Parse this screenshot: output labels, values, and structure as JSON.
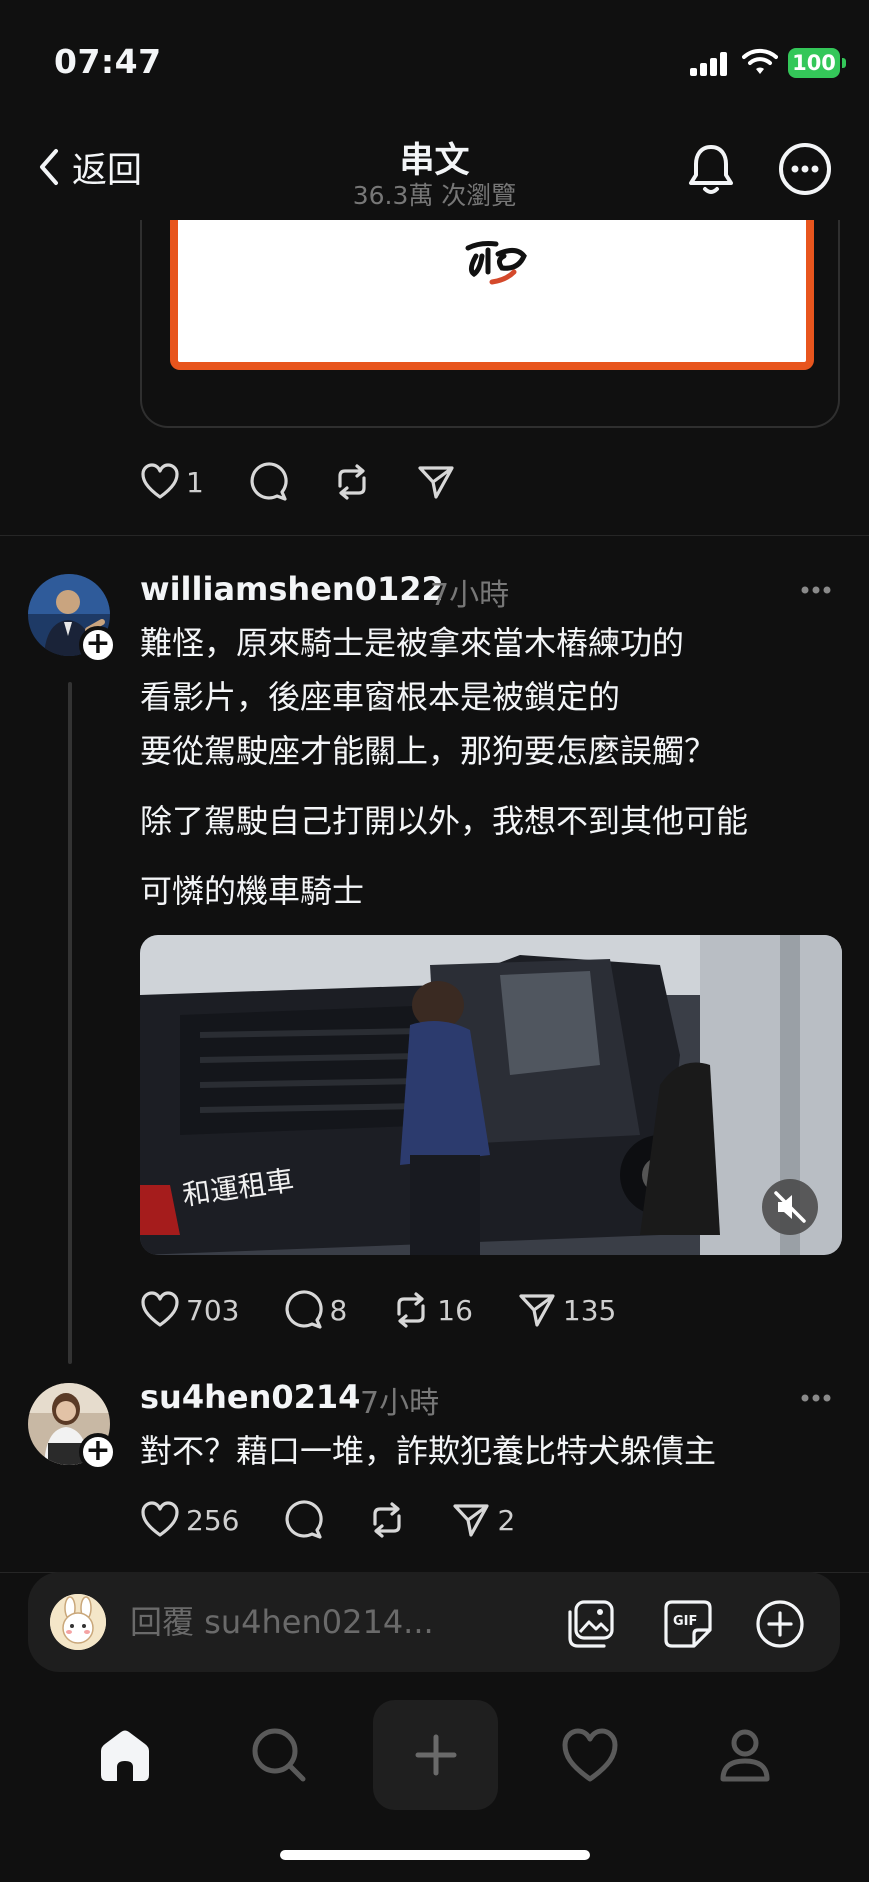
{
  "status_bar": {
    "time": "07:47",
    "battery": "100"
  },
  "header": {
    "back_label": "返回",
    "title": "串文",
    "subtitle": "36.3萬 次瀏覽"
  },
  "embed_actions": {
    "like_count": "1"
  },
  "posts": [
    {
      "username": "williamshen0122",
      "time": "7小時",
      "lines": [
        "難怪，原來騎士是被拿來當木樁練功的",
        "看影片，後座車窗根本是被鎖定的",
        "要從駕駛座才能關上，那狗要怎麼誤觸？"
      ],
      "paragraph2": "除了駕駛自己打開以外，我想不到其他可能",
      "paragraph3": "可憐的機車騎士",
      "video_caption": "和運租車",
      "likes": "703",
      "replies": "8",
      "reposts": "16",
      "shares": "135"
    },
    {
      "username": "su4hen0214",
      "time": "7小時",
      "text": "對不？藉口一堆，詐欺犯養比特犬躲債主",
      "likes": "256",
      "shares": "2"
    }
  ],
  "reply_bar": {
    "placeholder": "回覆 su4hen0214..."
  },
  "icons": {
    "back": "chevron-left-icon",
    "bell": "bell-icon",
    "more": "more-circle-icon",
    "like": "heart-icon",
    "reply": "comment-icon",
    "repost": "repost-icon",
    "share": "send-icon",
    "image": "image-icon",
    "gif": "gif-icon",
    "add": "plus-circle-icon",
    "home": "home-icon",
    "search": "search-icon",
    "create": "plus-icon",
    "activity": "heart-icon",
    "profile": "profile-icon",
    "mute": "speaker-muted-icon"
  },
  "colors": {
    "background": "#101010",
    "text": "#f3f5f7",
    "muted": "#777777",
    "battery": "#34c759",
    "embed_border": "#e8551d"
  }
}
